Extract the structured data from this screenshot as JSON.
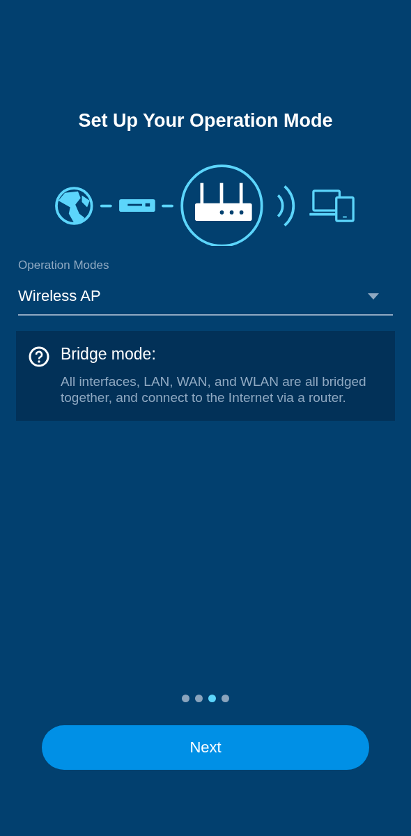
{
  "title": "Set Up Your Operation Mode",
  "mode_select": {
    "label": "Operation Modes",
    "value": "Wireless AP"
  },
  "info_card": {
    "title": "Bridge mode:",
    "description": "All interfaces, LAN, WAN, and WLAN are all bridged together, and connect to the Internet via a router."
  },
  "steps": [
    {
      "selected": false
    },
    {
      "selected": false
    },
    {
      "selected": true
    },
    {
      "selected": false
    }
  ],
  "next_button": "Next"
}
